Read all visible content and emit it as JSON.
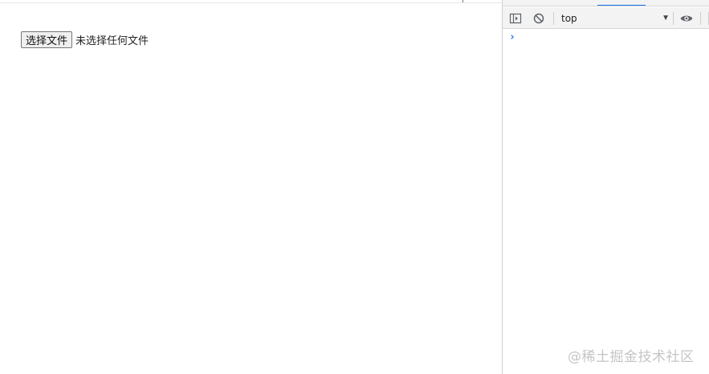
{
  "page": {
    "file_input": {
      "button_label": "选择文件",
      "status_text": "未选择任何文件"
    }
  },
  "devtools": {
    "toolbar": {
      "sidebar_toggle_icon": "sidebar-toggle-icon",
      "clear_console_icon": "clear-console-icon",
      "context_value": "top",
      "context_arrow": "▼",
      "live_expression_icon": "eye-icon"
    },
    "console": {
      "prompt": "›"
    },
    "colors": {
      "accent": "#1a73e8",
      "toolbar_bg": "#f3f3f3"
    }
  },
  "watermark": {
    "text": "@稀土掘金技术社区"
  }
}
